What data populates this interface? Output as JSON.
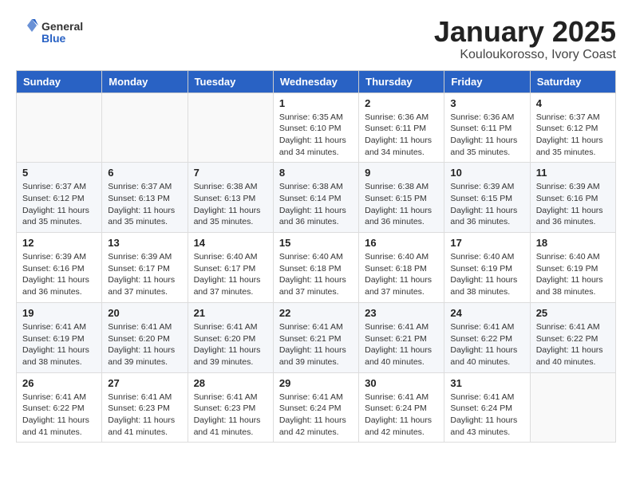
{
  "logo": {
    "general": "General",
    "blue": "Blue"
  },
  "title": "January 2025",
  "subtitle": "Kouloukorosso, Ivory Coast",
  "days_of_week": [
    "Sunday",
    "Monday",
    "Tuesday",
    "Wednesday",
    "Thursday",
    "Friday",
    "Saturday"
  ],
  "weeks": [
    [
      {
        "day": "",
        "info": ""
      },
      {
        "day": "",
        "info": ""
      },
      {
        "day": "",
        "info": ""
      },
      {
        "day": "1",
        "info": "Sunrise: 6:35 AM\nSunset: 6:10 PM\nDaylight: 11 hours and 34 minutes."
      },
      {
        "day": "2",
        "info": "Sunrise: 6:36 AM\nSunset: 6:11 PM\nDaylight: 11 hours and 34 minutes."
      },
      {
        "day": "3",
        "info": "Sunrise: 6:36 AM\nSunset: 6:11 PM\nDaylight: 11 hours and 35 minutes."
      },
      {
        "day": "4",
        "info": "Sunrise: 6:37 AM\nSunset: 6:12 PM\nDaylight: 11 hours and 35 minutes."
      }
    ],
    [
      {
        "day": "5",
        "info": "Sunrise: 6:37 AM\nSunset: 6:12 PM\nDaylight: 11 hours and 35 minutes."
      },
      {
        "day": "6",
        "info": "Sunrise: 6:37 AM\nSunset: 6:13 PM\nDaylight: 11 hours and 35 minutes."
      },
      {
        "day": "7",
        "info": "Sunrise: 6:38 AM\nSunset: 6:13 PM\nDaylight: 11 hours and 35 minutes."
      },
      {
        "day": "8",
        "info": "Sunrise: 6:38 AM\nSunset: 6:14 PM\nDaylight: 11 hours and 36 minutes."
      },
      {
        "day": "9",
        "info": "Sunrise: 6:38 AM\nSunset: 6:15 PM\nDaylight: 11 hours and 36 minutes."
      },
      {
        "day": "10",
        "info": "Sunrise: 6:39 AM\nSunset: 6:15 PM\nDaylight: 11 hours and 36 minutes."
      },
      {
        "day": "11",
        "info": "Sunrise: 6:39 AM\nSunset: 6:16 PM\nDaylight: 11 hours and 36 minutes."
      }
    ],
    [
      {
        "day": "12",
        "info": "Sunrise: 6:39 AM\nSunset: 6:16 PM\nDaylight: 11 hours and 36 minutes."
      },
      {
        "day": "13",
        "info": "Sunrise: 6:39 AM\nSunset: 6:17 PM\nDaylight: 11 hours and 37 minutes."
      },
      {
        "day": "14",
        "info": "Sunrise: 6:40 AM\nSunset: 6:17 PM\nDaylight: 11 hours and 37 minutes."
      },
      {
        "day": "15",
        "info": "Sunrise: 6:40 AM\nSunset: 6:18 PM\nDaylight: 11 hours and 37 minutes."
      },
      {
        "day": "16",
        "info": "Sunrise: 6:40 AM\nSunset: 6:18 PM\nDaylight: 11 hours and 37 minutes."
      },
      {
        "day": "17",
        "info": "Sunrise: 6:40 AM\nSunset: 6:19 PM\nDaylight: 11 hours and 38 minutes."
      },
      {
        "day": "18",
        "info": "Sunrise: 6:40 AM\nSunset: 6:19 PM\nDaylight: 11 hours and 38 minutes."
      }
    ],
    [
      {
        "day": "19",
        "info": "Sunrise: 6:41 AM\nSunset: 6:19 PM\nDaylight: 11 hours and 38 minutes."
      },
      {
        "day": "20",
        "info": "Sunrise: 6:41 AM\nSunset: 6:20 PM\nDaylight: 11 hours and 39 minutes."
      },
      {
        "day": "21",
        "info": "Sunrise: 6:41 AM\nSunset: 6:20 PM\nDaylight: 11 hours and 39 minutes."
      },
      {
        "day": "22",
        "info": "Sunrise: 6:41 AM\nSunset: 6:21 PM\nDaylight: 11 hours and 39 minutes."
      },
      {
        "day": "23",
        "info": "Sunrise: 6:41 AM\nSunset: 6:21 PM\nDaylight: 11 hours and 40 minutes."
      },
      {
        "day": "24",
        "info": "Sunrise: 6:41 AM\nSunset: 6:22 PM\nDaylight: 11 hours and 40 minutes."
      },
      {
        "day": "25",
        "info": "Sunrise: 6:41 AM\nSunset: 6:22 PM\nDaylight: 11 hours and 40 minutes."
      }
    ],
    [
      {
        "day": "26",
        "info": "Sunrise: 6:41 AM\nSunset: 6:22 PM\nDaylight: 11 hours and 41 minutes."
      },
      {
        "day": "27",
        "info": "Sunrise: 6:41 AM\nSunset: 6:23 PM\nDaylight: 11 hours and 41 minutes."
      },
      {
        "day": "28",
        "info": "Sunrise: 6:41 AM\nSunset: 6:23 PM\nDaylight: 11 hours and 41 minutes."
      },
      {
        "day": "29",
        "info": "Sunrise: 6:41 AM\nSunset: 6:24 PM\nDaylight: 11 hours and 42 minutes."
      },
      {
        "day": "30",
        "info": "Sunrise: 6:41 AM\nSunset: 6:24 PM\nDaylight: 11 hours and 42 minutes."
      },
      {
        "day": "31",
        "info": "Sunrise: 6:41 AM\nSunset: 6:24 PM\nDaylight: 11 hours and 43 minutes."
      },
      {
        "day": "",
        "info": ""
      }
    ]
  ]
}
